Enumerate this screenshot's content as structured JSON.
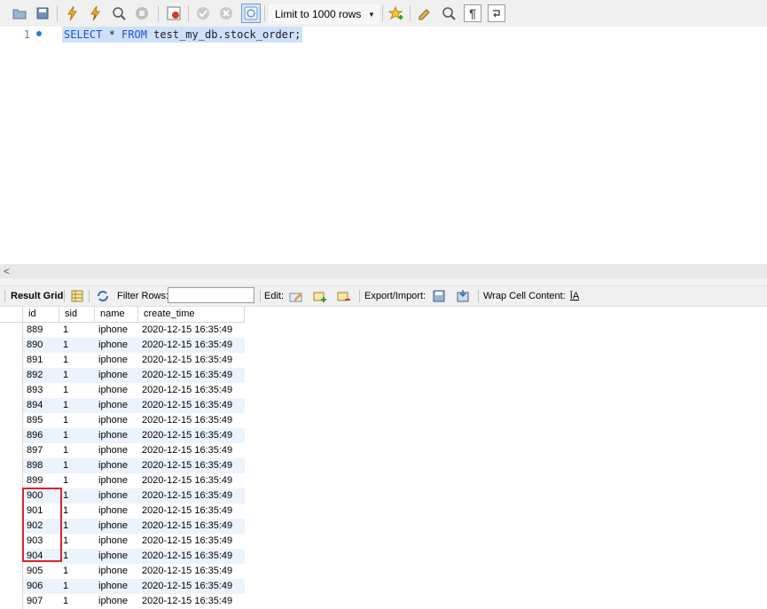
{
  "toolbar": {
    "limit_label": "Limit to 1000 rows",
    "icons": [
      "open-folder-icon",
      "save-icon",
      "execute-icon",
      "execute-current-icon",
      "explain-icon",
      "stop-icon",
      "toggle-error-stop-icon",
      "commit-icon",
      "rollback-icon",
      "autocommit-icon",
      "add-snippet-icon",
      "beautify-icon",
      "find-icon",
      "invisible-chars-icon",
      "wrap-icon"
    ]
  },
  "editor": {
    "line_number": "1",
    "sql_select": "SELECT",
    "sql_star": " * ",
    "sql_from": "FROM",
    "sql_rest": " test_my_db.stock_order;"
  },
  "scroll": {
    "left_arrow": "<"
  },
  "result_toolbar": {
    "result_grid": "Result Grid",
    "filter_rows": "Filter Rows:",
    "filter_value": "",
    "edit": "Edit:",
    "export_import": "Export/Import:",
    "wrap_cell": "Wrap Cell Content:"
  },
  "grid": {
    "columns": [
      "id",
      "sid",
      "name",
      "create_time"
    ],
    "rows": [
      [
        "889",
        "1",
        "iphone",
        "2020-12-15 16:35:49"
      ],
      [
        "890",
        "1",
        "iphone",
        "2020-12-15 16:35:49"
      ],
      [
        "891",
        "1",
        "iphone",
        "2020-12-15 16:35:49"
      ],
      [
        "892",
        "1",
        "iphone",
        "2020-12-15 16:35:49"
      ],
      [
        "893",
        "1",
        "iphone",
        "2020-12-15 16:35:49"
      ],
      [
        "894",
        "1",
        "iphone",
        "2020-12-15 16:35:49"
      ],
      [
        "895",
        "1",
        "iphone",
        "2020-12-15 16:35:49"
      ],
      [
        "896",
        "1",
        "iphone",
        "2020-12-15 16:35:49"
      ],
      [
        "897",
        "1",
        "iphone",
        "2020-12-15 16:35:49"
      ],
      [
        "898",
        "1",
        "iphone",
        "2020-12-15 16:35:49"
      ],
      [
        "899",
        "1",
        "iphone",
        "2020-12-15 16:35:49"
      ],
      [
        "900",
        "1",
        "iphone",
        "2020-12-15 16:35:49"
      ],
      [
        "901",
        "1",
        "iphone",
        "2020-12-15 16:35:49"
      ],
      [
        "902",
        "1",
        "iphone",
        "2020-12-15 16:35:49"
      ],
      [
        "903",
        "1",
        "iphone",
        "2020-12-15 16:35:49"
      ],
      [
        "904",
        "1",
        "iphone",
        "2020-12-15 16:35:49"
      ],
      [
        "905",
        "1",
        "iphone",
        "2020-12-15 16:35:49"
      ],
      [
        "906",
        "1",
        "iphone",
        "2020-12-15 16:35:49"
      ],
      [
        "907",
        "1",
        "iphone",
        "2020-12-15 16:35:49"
      ]
    ]
  },
  "colors": {
    "highlight": "#d9262a",
    "selection": "#cfe1f7",
    "keyword": "#1a4fd0",
    "alt_row": "#ebf3fc"
  }
}
